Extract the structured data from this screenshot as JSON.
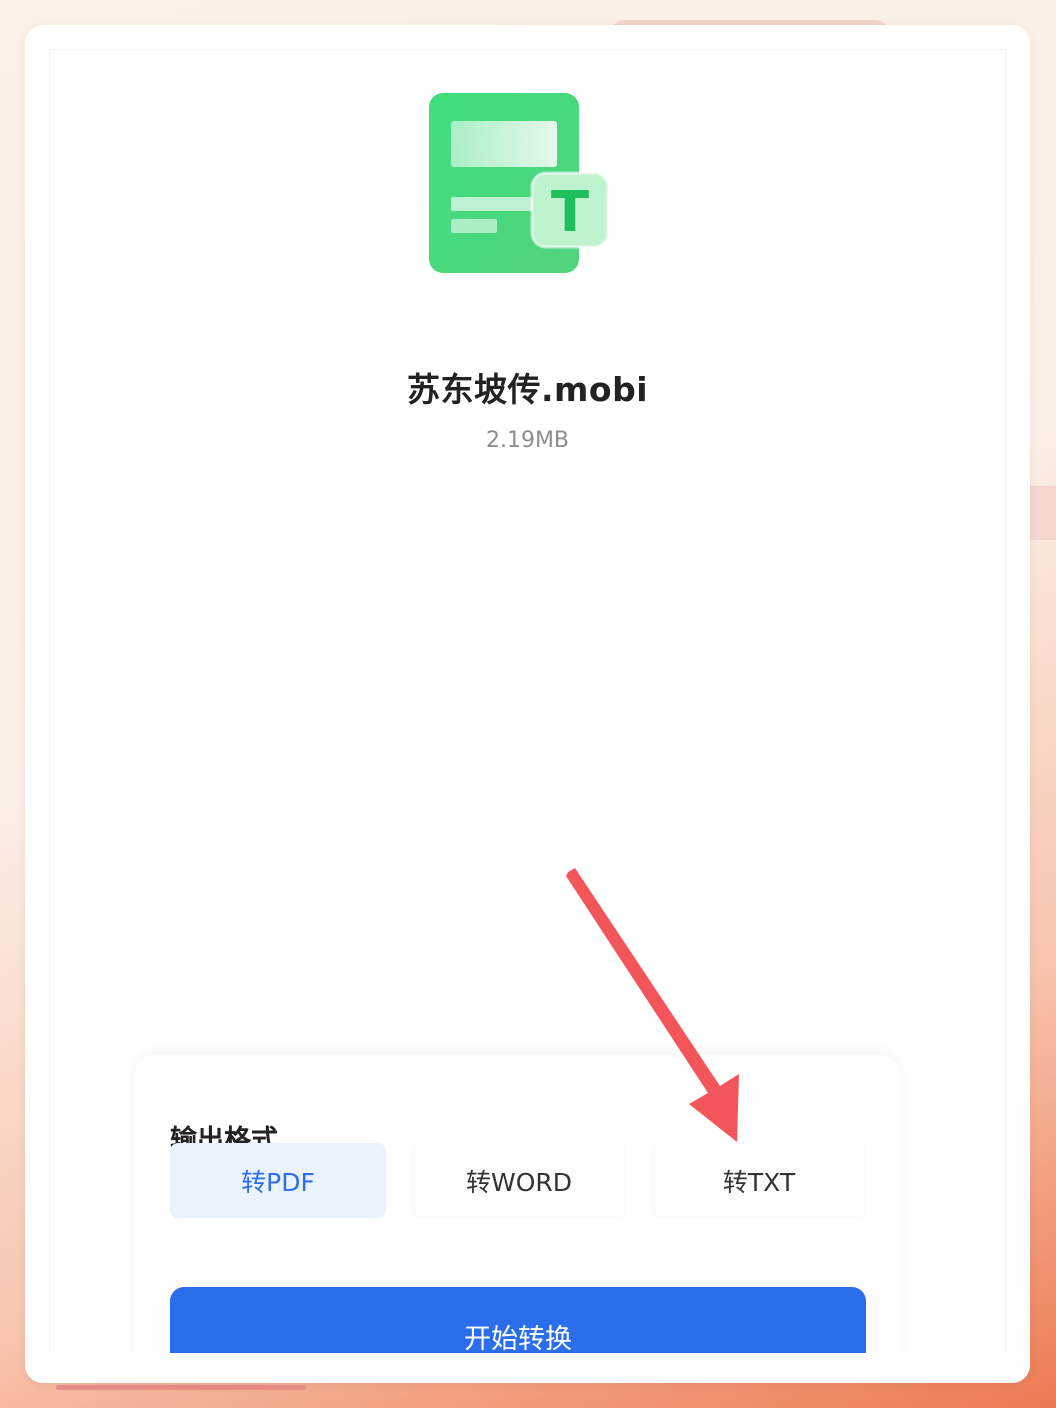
{
  "file": {
    "name": "苏东坡传.mobi",
    "size": "2.19MB",
    "icon": "txt-document-icon",
    "icon_letter": "T"
  },
  "output": {
    "title": "输出格式",
    "options": [
      {
        "label": "转PDF",
        "selected": true
      },
      {
        "label": "转WORD",
        "selected": false
      },
      {
        "label": "转TXT",
        "selected": false
      }
    ]
  },
  "start_button": {
    "label": "开始转换"
  },
  "colors": {
    "accent_blue": "#2b6eec",
    "selected_bg": "#eaf3fe",
    "icon_green": "#3fd97a",
    "annotation_arrow": "#f2555a"
  }
}
